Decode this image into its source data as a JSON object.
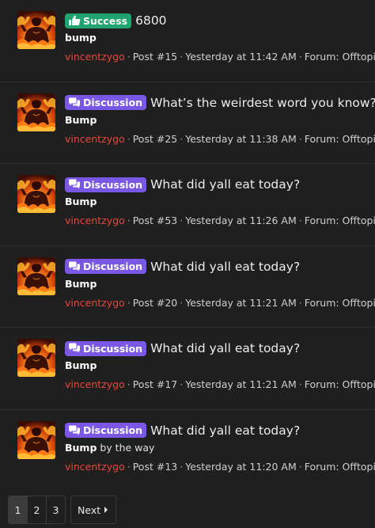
{
  "results": [
    {
      "badge": "Success",
      "badge_type": "success",
      "badge_icon": "thumbs-up-icon",
      "title": "6800",
      "snippet_bold": "bump",
      "snippet_rest": "",
      "author": "vincentzygo",
      "post": "Post #15",
      "time": "Yesterday at 11:42 AM",
      "forum": "Forum: Offtopic"
    },
    {
      "badge": "Discussion",
      "badge_type": "discussion",
      "badge_icon": "comments-icon",
      "title": "What’s the weirdest word you know?",
      "snippet_bold": "Bump",
      "snippet_rest": "",
      "author": "vincentzygo",
      "post": "Post #25",
      "time": "Yesterday at 11:38 AM",
      "forum": "Forum: Offtopic"
    },
    {
      "badge": "Discussion",
      "badge_type": "discussion",
      "badge_icon": "comments-icon",
      "title": "What did yall eat today?",
      "snippet_bold": "Bump",
      "snippet_rest": "",
      "author": "vincentzygo",
      "post": "Post #53",
      "time": "Yesterday at 11:26 AM",
      "forum": "Forum: Offtopic"
    },
    {
      "badge": "Discussion",
      "badge_type": "discussion",
      "badge_icon": "comments-icon",
      "title": "What did yall eat today?",
      "snippet_bold": "Bump",
      "snippet_rest": "",
      "author": "vincentzygo",
      "post": "Post #20",
      "time": "Yesterday at 11:21 AM",
      "forum": "Forum: Offtopic"
    },
    {
      "badge": "Discussion",
      "badge_type": "discussion",
      "badge_icon": "comments-icon",
      "title": "What did yall eat today?",
      "snippet_bold": "Bump",
      "snippet_rest": "",
      "author": "vincentzygo",
      "post": "Post #17",
      "time": "Yesterday at 11:21 AM",
      "forum": "Forum: Offtopic"
    },
    {
      "badge": "Discussion",
      "badge_type": "discussion",
      "badge_icon": "comments-icon",
      "title": "What did yall eat today?",
      "snippet_bold": "Bump",
      "snippet_rest": " by the way",
      "author": "vincentzygo",
      "post": "Post #13",
      "time": "Yesterday at 11:20 AM",
      "forum": "Forum: Offtopic"
    }
  ],
  "separator": "·",
  "pagination": {
    "pages": [
      "1",
      "2",
      "3"
    ],
    "current": "1",
    "next_label": "Next",
    "next_icon": "chevron-right-icon"
  },
  "colors": {
    "background": "#1f1f1f",
    "author": "#e6473a",
    "success_badge": "#20a36f",
    "discussion_badge": "#7b57e6"
  }
}
